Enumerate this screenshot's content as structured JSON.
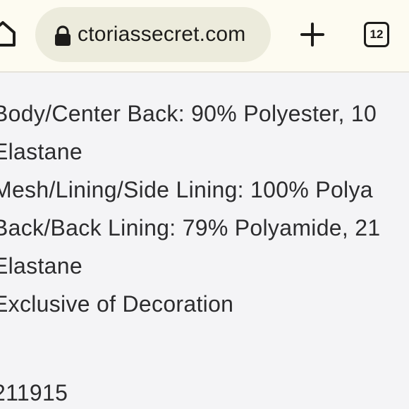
{
  "browser": {
    "url_text": "ctoriassecret.com",
    "tab_count": "12",
    "icons": {
      "home": "home-icon",
      "lock": "lock-icon",
      "new_tab": "plus-icon",
      "tabs": "tab-switcher-icon"
    }
  },
  "content": {
    "lines": [
      "Body/Center Back: 90% Polyester, 10",
      "Elastane",
      "Mesh/Lining/Side Lining: 100% Polya",
      "Back/Back Lining: 79% Polyamide, 21",
      "Elastane",
      "Exclusive of Decoration",
      "",
      "211915"
    ]
  },
  "colors": {
    "toolbar_bg": "#fdfbf1",
    "url_pill_bg": "#ecebdc",
    "page_bg": "#f4f4f6",
    "text": "#2c2c2e"
  }
}
